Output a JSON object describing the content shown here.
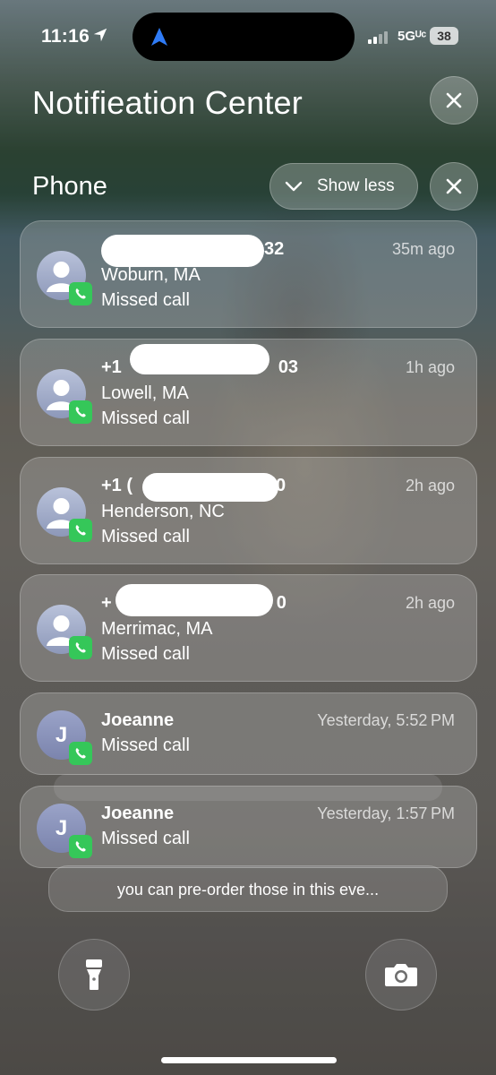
{
  "status_bar": {
    "time": "11:16",
    "network": "5Gᵁᶜ",
    "battery": "38"
  },
  "header": {
    "title": "Notifieation Center"
  },
  "group": {
    "title": "Phone",
    "show_less_label": "Show less"
  },
  "notifications": [
    {
      "name": "",
      "name_visible_suffix": "32",
      "name_visible_prefix": "",
      "location": "Woburn, MA",
      "message": "Missed call",
      "time": "35m ago"
    },
    {
      "name_visible_prefix": "+1",
      "name_visible_suffix": "03",
      "location": "Lowell, MA",
      "message": "Missed call",
      "time": "1h ago"
    },
    {
      "name_visible_prefix": "+1 (",
      "name_visible_suffix": "0",
      "location": "Henderson, NC",
      "message": "Missed call",
      "time": "2h ago"
    },
    {
      "name_visible_prefix": "+",
      "name_visible_suffix": "0",
      "location": "Merrimac, MA",
      "message": "Missed call",
      "time": "2h ago"
    },
    {
      "name": "Joeanne",
      "avatar_letter": "J",
      "message": "Missed call",
      "time": "Yesterday, 5:52 PM"
    },
    {
      "name": "Joeanne",
      "avatar_letter": "J",
      "message": "Missed call",
      "time": "Yesterday, 1:57 PM"
    }
  ],
  "stacked_preview": "you can pre-order those in this eve...",
  "icons": {
    "close": "close-icon",
    "chevron": "chevron-down-icon",
    "flashlight": "flashlight-icon",
    "camera": "camera-icon",
    "phone_badge": "phone-icon",
    "contact": "person-icon"
  },
  "colors": {
    "badge_green": "#35c759"
  }
}
